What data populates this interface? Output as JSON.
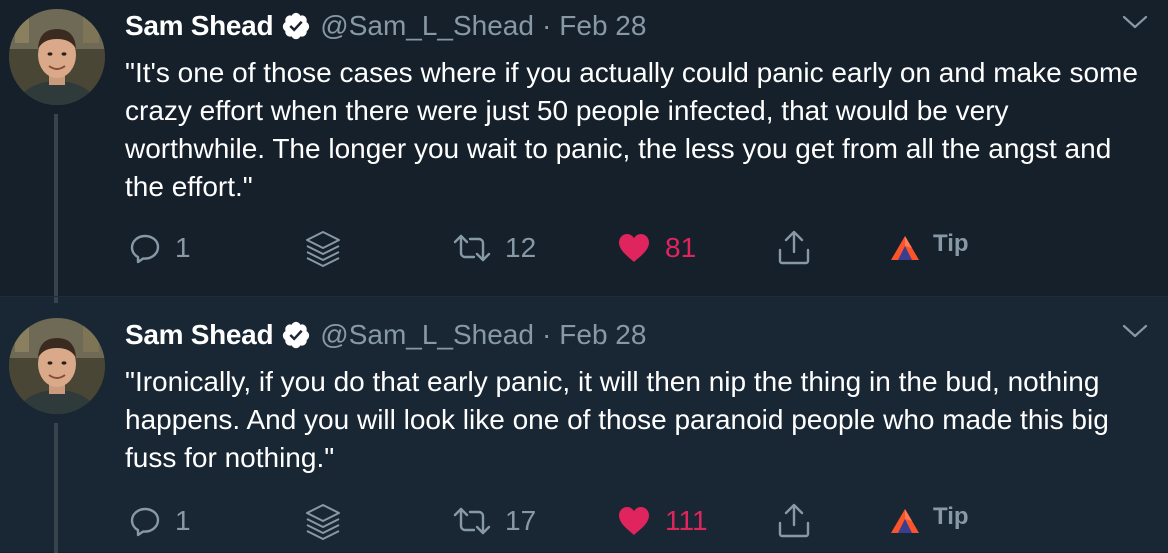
{
  "colors": {
    "background": "#15202b",
    "background_alt": "#192734",
    "text": "#ffffff",
    "muted": "#8899a6",
    "like": "#e0245e",
    "verified": "#ffffff",
    "tip_brave": "#fb542b"
  },
  "tweets": [
    {
      "author_name": "Sam Shead",
      "handle": "@Sam_L_Shead",
      "separator": "·",
      "date": "Feb 28",
      "text": "\"It's one of those cases where if you actually could panic early on and make some crazy effort when there were just 50 people infected, that would be very worthwhile. The longer you wait to panic, the less you get from all the angst and the effort.\"",
      "replies": "1",
      "retweets": "12",
      "likes": "81",
      "liked": true,
      "tip_label": "Tip"
    },
    {
      "author_name": "Sam Shead",
      "handle": "@Sam_L_Shead",
      "separator": "·",
      "date": "Feb 28",
      "text": "\"Ironically, if you do that early panic, it will then nip the thing in the bud, nothing happens. And you will look like one of those paranoid people who made this big fuss for nothing.\"",
      "replies": "1",
      "retweets": "17",
      "likes": "111",
      "liked": true,
      "tip_label": "Tip"
    }
  ]
}
